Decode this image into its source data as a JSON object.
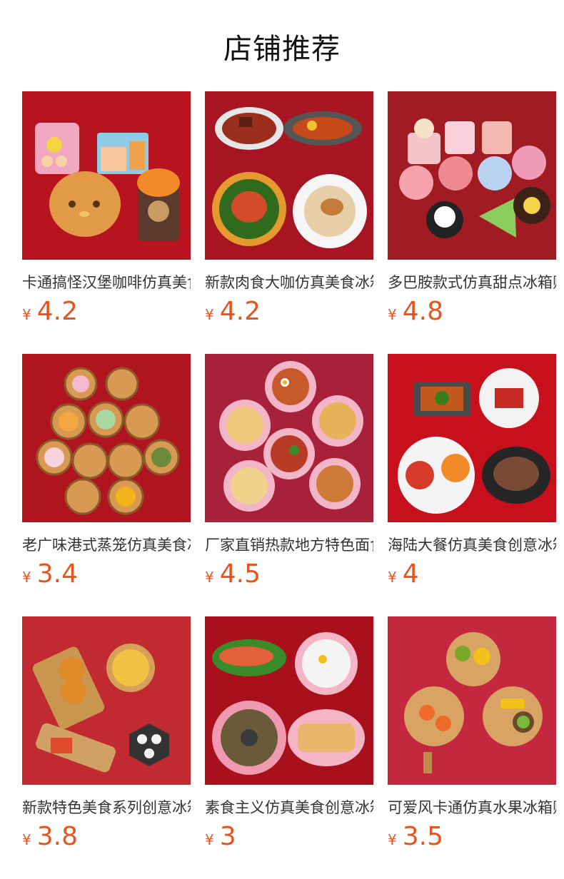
{
  "page": {
    "title": "店铺推荐"
  },
  "products": [
    {
      "name": "卡通搞怪汉堡咖啡仿真美食冰箱贴",
      "currency": "¥",
      "price": "4.2",
      "bg": "#b8141f",
      "image_icon": "cartoon-food-icon"
    },
    {
      "name": "新款肉食大咖仿真美食冰箱贴",
      "currency": "¥",
      "price": "4.2",
      "bg": "#a81522",
      "image_icon": "meat-dish-icon"
    },
    {
      "name": "多巴胺款式仿真甜点冰箱贴",
      "currency": "¥",
      "price": "4.8",
      "bg": "#a11b22",
      "image_icon": "cake-icon"
    },
    {
      "name": "老广味港式蒸笼仿真美食冰箱贴",
      "currency": "¥",
      "price": "3.4",
      "bg": "#b0141f",
      "image_icon": "dim-sum-icon"
    },
    {
      "name": "厂家直销热款地方特色面食冰箱贴",
      "currency": "¥",
      "price": "4.5",
      "bg": "#a8213a",
      "image_icon": "noodle-bowl-icon"
    },
    {
      "name": "海陆大餐仿真美食创意冰箱贴",
      "currency": "¥",
      "price": "4",
      "bg": "#c8101c",
      "image_icon": "seafood-icon"
    },
    {
      "name": "新款特色美食系列创意冰箱贴",
      "currency": "¥",
      "price": "3.8",
      "bg": "#c02a30",
      "image_icon": "snack-board-icon"
    },
    {
      "name": "素食主义仿真美食创意冰箱贴",
      "currency": "¥",
      "price": "3",
      "bg": "#a8101c",
      "image_icon": "veggie-plate-icon"
    },
    {
      "name": "可爱风卡通仿真水果冰箱贴",
      "currency": "¥",
      "price": "3.5",
      "bg": "#c3283f",
      "image_icon": "fruit-board-icon"
    }
  ]
}
